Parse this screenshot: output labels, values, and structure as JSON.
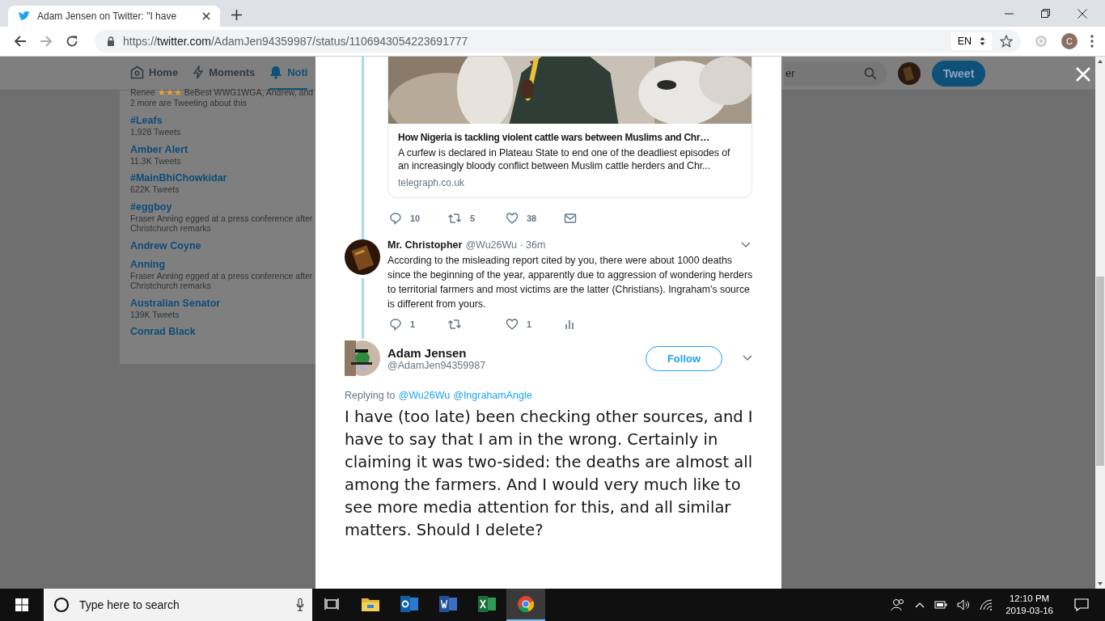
{
  "browser": {
    "tab_title": "Adam Jensen on Twitter: \"I have",
    "url_scheme": "https://",
    "url_host": "twitter.com",
    "url_path": "/AdamJen94359987/status/1106943054223691777",
    "language": "EN",
    "profile_initial": "C"
  },
  "background_page": {
    "nav": [
      {
        "kind": "home",
        "label": "Home",
        "selected": false
      },
      {
        "kind": "moments",
        "label": "Moments",
        "selected": false
      },
      {
        "kind": "notifications",
        "label": "Noti",
        "selected": true
      }
    ],
    "search": {
      "placeholder": "er"
    },
    "tweet_button": "Tweet",
    "trends_context": {
      "name": "Renee",
      "emoji": "★★★",
      "names": "BeBest WWG1WGA, Andrew,",
      "extra": "and 2 more are Tweeting about this"
    },
    "trends": [
      {
        "title": "#Leafs",
        "meta": "1,928 Tweets"
      },
      {
        "title": "Amber Alert",
        "meta": "11.3K Tweets"
      },
      {
        "title": "#MainBhiChowkidar",
        "meta": "622K Tweets"
      },
      {
        "title": "#eggboy",
        "meta": "Fraser Anning egged at a press conference after Christchurch remarks"
      },
      {
        "title": "Andrew Coyne"
      },
      {
        "title": "Anning",
        "meta": "Fraser Anning egged at a press conference after Christchurch remarks"
      },
      {
        "title": "Australian Senator",
        "meta": "139K Tweets"
      },
      {
        "title": "Conrad Black"
      }
    ]
  },
  "modal": {
    "link_card": {
      "kind": "picture",
      "title": "How Nigeria is tackling violent cattle wars between Muslims and Chr…",
      "description": "A curfew is declared in Plateau State to end one of the deadliest episodes of an increasingly bloody conflict between Muslim cattle herders and Chr...",
      "domain": "telegraph.co.uk"
    },
    "card_actions": [
      {
        "kind": "reply",
        "count": "10"
      },
      {
        "kind": "retweet",
        "count": "5"
      },
      {
        "kind": "like",
        "count": "38"
      },
      {
        "kind": "message"
      }
    ],
    "reply": {
      "name": "Mr. Christopher",
      "handle": "@Wu26Wu",
      "time": "· 36m",
      "text": "According to the misleading report cited by you, there were about 1000 deaths since the beginning of the year, apparently due to aggression of wondering herders to territorial farmers and most victims are the latter (Christians). Ingraham's source is different from yours.",
      "actions": [
        {
          "kind": "reply",
          "count": "1"
        },
        {
          "kind": "retweet"
        },
        {
          "kind": "like",
          "count": "1"
        },
        {
          "kind": "analytics"
        }
      ]
    },
    "tweet": {
      "name": "Adam Jensen",
      "handle": "@AdamJen94359987",
      "follow_button": "Follow",
      "replying_label": "Replying to",
      "mentions": [
        "@Wu26Wu",
        "@IngrahamAngle"
      ],
      "text": "I have (too late) been checking other sources, and I have to say that I am in the wrong. Certainly in claiming it was two-sided: the deaths are almost all among the farmers. And I would very much like to see more media attention for this, and all similar matters. Should I delete?"
    }
  },
  "taskbar": {
    "search_placeholder": "Type here to search",
    "apps": [
      {
        "kind": "taskview",
        "selected": false
      },
      {
        "kind": "explorer",
        "selected": false
      },
      {
        "kind": "outlook",
        "selected": false
      },
      {
        "kind": "word",
        "selected": false
      },
      {
        "kind": "excel",
        "selected": false
      },
      {
        "kind": "chrome",
        "selected": true
      }
    ],
    "time": "12:10 PM",
    "date": "2019-03-16"
  }
}
